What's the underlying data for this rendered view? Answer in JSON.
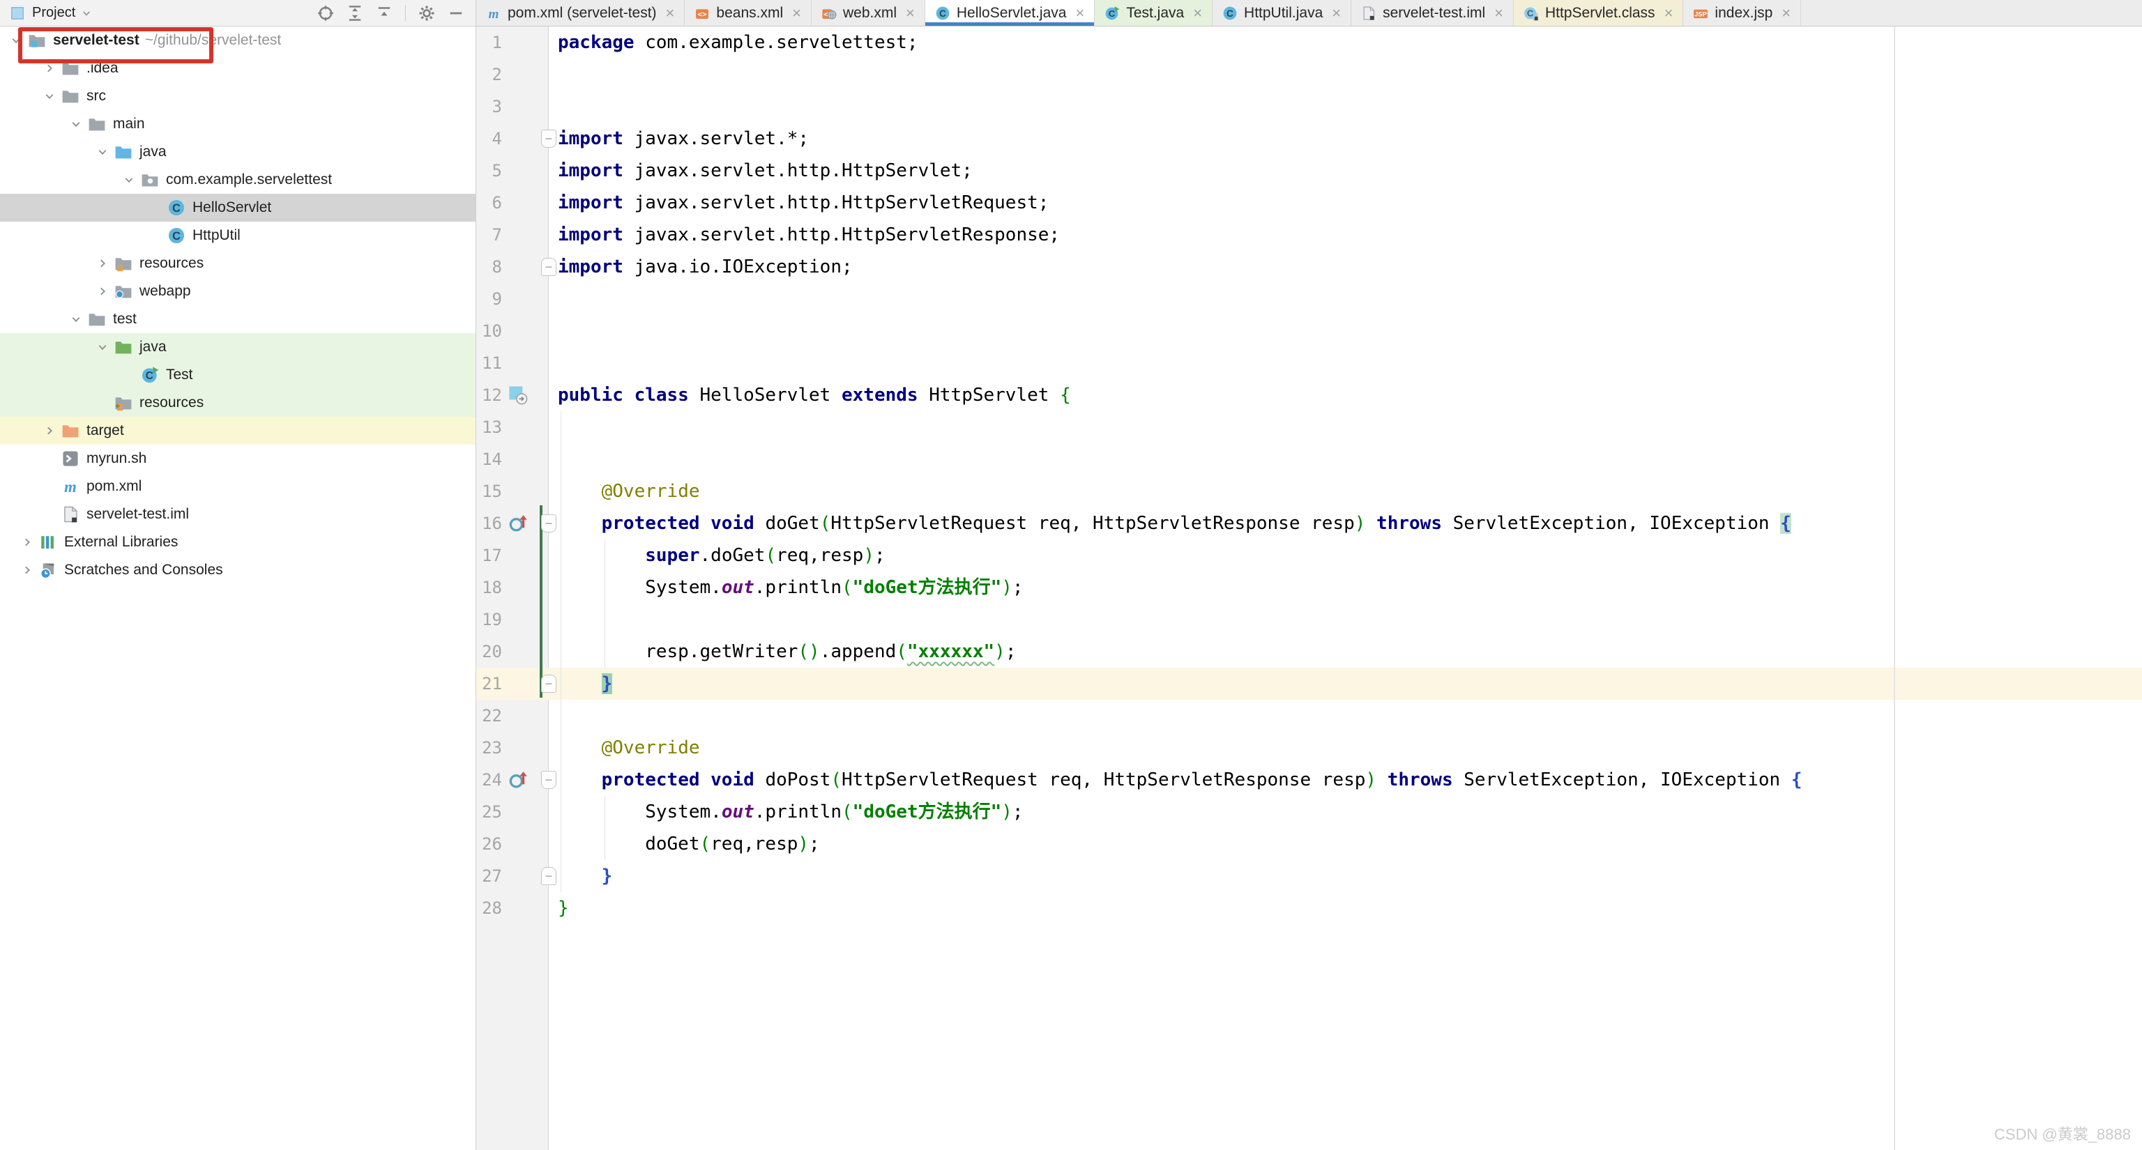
{
  "project_panel": {
    "header": {
      "title": "Project",
      "icons": [
        "locate",
        "expand-all",
        "collapse-all",
        "gear",
        "minimize"
      ]
    },
    "tree": [
      {
        "id": "servelet-test-root",
        "label": "servelet-test",
        "path": " ~/github/servelet-test",
        "level": 0,
        "root": true,
        "chevron": "expanded",
        "icon": "project-folder",
        "bold": true
      },
      {
        "id": "idea",
        "label": ".idea",
        "level": 1,
        "chevron": "collapsed",
        "icon": "folder"
      },
      {
        "id": "src",
        "label": "src",
        "level": 1,
        "chevron": "expanded",
        "icon": "folder"
      },
      {
        "id": "main",
        "label": "main",
        "level": 2,
        "chevron": "expanded",
        "icon": "folder"
      },
      {
        "id": "java-main",
        "label": "java",
        "level": 3,
        "chevron": "expanded",
        "icon": "sources-folder"
      },
      {
        "id": "com-example-servelettest",
        "label": "com.example.servelettest",
        "level": 4,
        "chevron": "expanded",
        "icon": "package-folder"
      },
      {
        "id": "helloservlet",
        "label": "HelloServlet",
        "level": 5,
        "icon": "java-class",
        "row": "sel"
      },
      {
        "id": "httputil",
        "label": "HttpUtil",
        "level": 5,
        "icon": "java-class"
      },
      {
        "id": "resources-main",
        "label": "resources",
        "level": 3,
        "chevron": "collapsed",
        "icon": "resources-folder"
      },
      {
        "id": "webapp",
        "label": "webapp",
        "level": 3,
        "chevron": "collapsed",
        "icon": "webapp-folder"
      },
      {
        "id": "test",
        "label": "test",
        "level": 2,
        "chevron": "expanded",
        "icon": "folder"
      },
      {
        "id": "java-test",
        "label": "java",
        "level": 3,
        "chevron": "expanded",
        "icon": "test-sources-folder",
        "row": "test"
      },
      {
        "id": "test-class",
        "label": "Test",
        "level": 4,
        "icon": "java-class-run",
        "row": "test"
      },
      {
        "id": "resources-test",
        "label": "resources",
        "level": 3,
        "icon": "test-resources-folder",
        "row": "test"
      },
      {
        "id": "target",
        "label": "target",
        "level": 1,
        "chevron": "collapsed",
        "icon": "excluded-folder",
        "row": "excl"
      },
      {
        "id": "myrun-sh",
        "label": "myrun.sh",
        "level": 1,
        "icon": "shell-file"
      },
      {
        "id": "pom-xml",
        "label": "pom.xml",
        "level": 1,
        "icon": "maven-file"
      },
      {
        "id": "servelet-test-iml",
        "label": "servelet-test.iml",
        "level": 1,
        "icon": "iml-file"
      },
      {
        "id": "external-libraries",
        "label": "External Libraries",
        "level": 0,
        "chevron": "collapsed",
        "icon": "libraries"
      },
      {
        "id": "scratches-and-consoles",
        "label": "Scratches and Consoles",
        "level": 0,
        "chevron": "collapsed",
        "icon": "scratches"
      }
    ]
  },
  "tabs": [
    {
      "id": "pom-xml",
      "label": "pom.xml (servelet-test)",
      "icon": "maven-file",
      "close": "×"
    },
    {
      "id": "beans-xml",
      "label": "beans.xml",
      "icon": "xml-file",
      "close": "×"
    },
    {
      "id": "web-xml",
      "label": "web.xml",
      "icon": "web-xml-file",
      "close": "×"
    },
    {
      "id": "helloservlet-java",
      "label": "HelloServlet.java",
      "icon": "java-class",
      "state": "active",
      "close": "×"
    },
    {
      "id": "test-java",
      "label": "Test.java",
      "icon": "java-class-run",
      "state": "test",
      "close": "×"
    },
    {
      "id": "httputil-java",
      "label": "HttpUtil.java",
      "icon": "java-class",
      "close": "×"
    },
    {
      "id": "servelet-test-iml",
      "label": "servelet-test.iml",
      "icon": "iml-file",
      "close": "×"
    },
    {
      "id": "httpservlet-class",
      "label": "HttpServlet.class",
      "icon": "java-class-library",
      "state": "library",
      "close": "×"
    },
    {
      "id": "index-jsp",
      "label": "index.jsp",
      "icon": "jsp-file",
      "close": "×"
    }
  ],
  "editor": {
    "current_line": 21,
    "vcs_new_lines": [
      16,
      21
    ],
    "lines": [
      {
        "n": 1,
        "seg": [
          [
            "k",
            "package "
          ],
          [
            "p",
            "com.example.servelettest;"
          ]
        ]
      },
      {
        "n": 2,
        "seg": []
      },
      {
        "n": 3,
        "seg": []
      },
      {
        "n": 4,
        "fold": "open",
        "seg": [
          [
            "k",
            "import "
          ],
          [
            "p",
            "javax.servlet.*;"
          ]
        ]
      },
      {
        "n": 5,
        "seg": [
          [
            "k",
            "import "
          ],
          [
            "p",
            "javax.servlet.http.HttpServlet;"
          ]
        ]
      },
      {
        "n": 6,
        "seg": [
          [
            "k",
            "import "
          ],
          [
            "p",
            "javax.servlet.http.HttpServletRequest;"
          ]
        ]
      },
      {
        "n": 7,
        "seg": [
          [
            "k",
            "import "
          ],
          [
            "p",
            "javax.servlet.http.HttpServletResponse;"
          ]
        ]
      },
      {
        "n": 8,
        "fold": "close",
        "seg": [
          [
            "k",
            "import "
          ],
          [
            "p",
            "java.io.IOException;"
          ]
        ]
      },
      {
        "n": 9,
        "seg": []
      },
      {
        "n": 10,
        "seg": []
      },
      {
        "n": 11,
        "seg": []
      },
      {
        "n": 12,
        "gicon": "servlet-class",
        "seg": [
          [
            "k",
            "public class "
          ],
          [
            "p",
            "HelloServlet "
          ],
          [
            "k",
            "extends "
          ],
          [
            "p",
            "HttpServlet "
          ],
          [
            "g",
            "{"
          ]
        ]
      },
      {
        "n": 13,
        "seg": []
      },
      {
        "n": 14,
        "seg": []
      },
      {
        "n": 15,
        "seg": [
          [
            "p",
            "    "
          ],
          [
            "a",
            "@Override"
          ]
        ]
      },
      {
        "n": 16,
        "fold": "open",
        "gicon": "override",
        "seg": [
          [
            "p",
            "    "
          ],
          [
            "k",
            "protected void "
          ],
          [
            "p",
            "doGet"
          ],
          [
            "g",
            "("
          ],
          [
            "p",
            "HttpServletRequest req, HttpServletResponse resp"
          ],
          [
            "g",
            ")"
          ],
          [
            "p",
            " "
          ],
          [
            "k",
            "throws "
          ],
          [
            "p",
            "ServletException, IOException "
          ],
          [
            "m1",
            "{"
          ]
        ]
      },
      {
        "n": 17,
        "seg": [
          [
            "p",
            "        "
          ],
          [
            "k",
            "super"
          ],
          [
            "p",
            ".doGet"
          ],
          [
            "g",
            "("
          ],
          [
            "p",
            "req,resp"
          ],
          [
            "g",
            ")"
          ],
          [
            "p",
            ";"
          ]
        ]
      },
      {
        "n": 18,
        "seg": [
          [
            "p",
            "        System."
          ],
          [
            "f",
            "out"
          ],
          [
            "p",
            ".println"
          ],
          [
            "g",
            "("
          ],
          [
            "s",
            "\"doGet方法执行\""
          ],
          [
            "g",
            ")"
          ],
          [
            "p",
            ";"
          ]
        ]
      },
      {
        "n": 19,
        "seg": []
      },
      {
        "n": 20,
        "seg": [
          [
            "p",
            "        resp.getWriter"
          ],
          [
            "g",
            "()"
          ],
          [
            "p",
            ".append"
          ],
          [
            "g",
            "("
          ],
          [
            "w",
            "\"xxxxxx\""
          ],
          [
            "g",
            ")"
          ],
          [
            "p",
            ";"
          ]
        ]
      },
      {
        "n": 21,
        "fold": "close",
        "seg": [
          [
            "p",
            "    "
          ],
          [
            "m2",
            "}"
          ]
        ]
      },
      {
        "n": 22,
        "seg": []
      },
      {
        "n": 23,
        "seg": [
          [
            "p",
            "    "
          ],
          [
            "a",
            "@Override"
          ]
        ]
      },
      {
        "n": 24,
        "fold": "open",
        "gicon": "override",
        "seg": [
          [
            "p",
            "    "
          ],
          [
            "k",
            "protected void "
          ],
          [
            "p",
            "doPost"
          ],
          [
            "g",
            "("
          ],
          [
            "p",
            "HttpServletRequest req, HttpServletResponse resp"
          ],
          [
            "g",
            ")"
          ],
          [
            "p",
            " "
          ],
          [
            "k",
            "throws "
          ],
          [
            "p",
            "ServletException, IOException "
          ],
          [
            "b",
            "{"
          ]
        ]
      },
      {
        "n": 25,
        "seg": [
          [
            "p",
            "        System."
          ],
          [
            "f",
            "out"
          ],
          [
            "p",
            ".println"
          ],
          [
            "g",
            "("
          ],
          [
            "s",
            "\"doGet方法执行\""
          ],
          [
            "g",
            ")"
          ],
          [
            "p",
            ";"
          ]
        ]
      },
      {
        "n": 26,
        "seg": [
          [
            "p",
            "        doGet"
          ],
          [
            "g",
            "("
          ],
          [
            "p",
            "req,resp"
          ],
          [
            "g",
            ")"
          ],
          [
            "p",
            ";"
          ]
        ]
      },
      {
        "n": 27,
        "fold": "close",
        "seg": [
          [
            "p",
            "    "
          ],
          [
            "b",
            "}"
          ]
        ]
      },
      {
        "n": 28,
        "seg": [
          [
            "g",
            "}"
          ]
        ]
      }
    ]
  },
  "watermark": "CSDN @黄裳_8888",
  "colors": {
    "active_tab_underline": "#4285C9",
    "annotation_box_red": "#D3342B",
    "current_line_bg": "#FCF6E2",
    "selected_row_bg": "#D4D4D4",
    "test_row_bg": "#E9F5E3",
    "excluded_row_bg": "#FAF7D5",
    "keyword": "#000080",
    "string": "#008000",
    "annotation": "#808000",
    "field": "#660E7A",
    "vcs_added": "#3E7A4E"
  }
}
